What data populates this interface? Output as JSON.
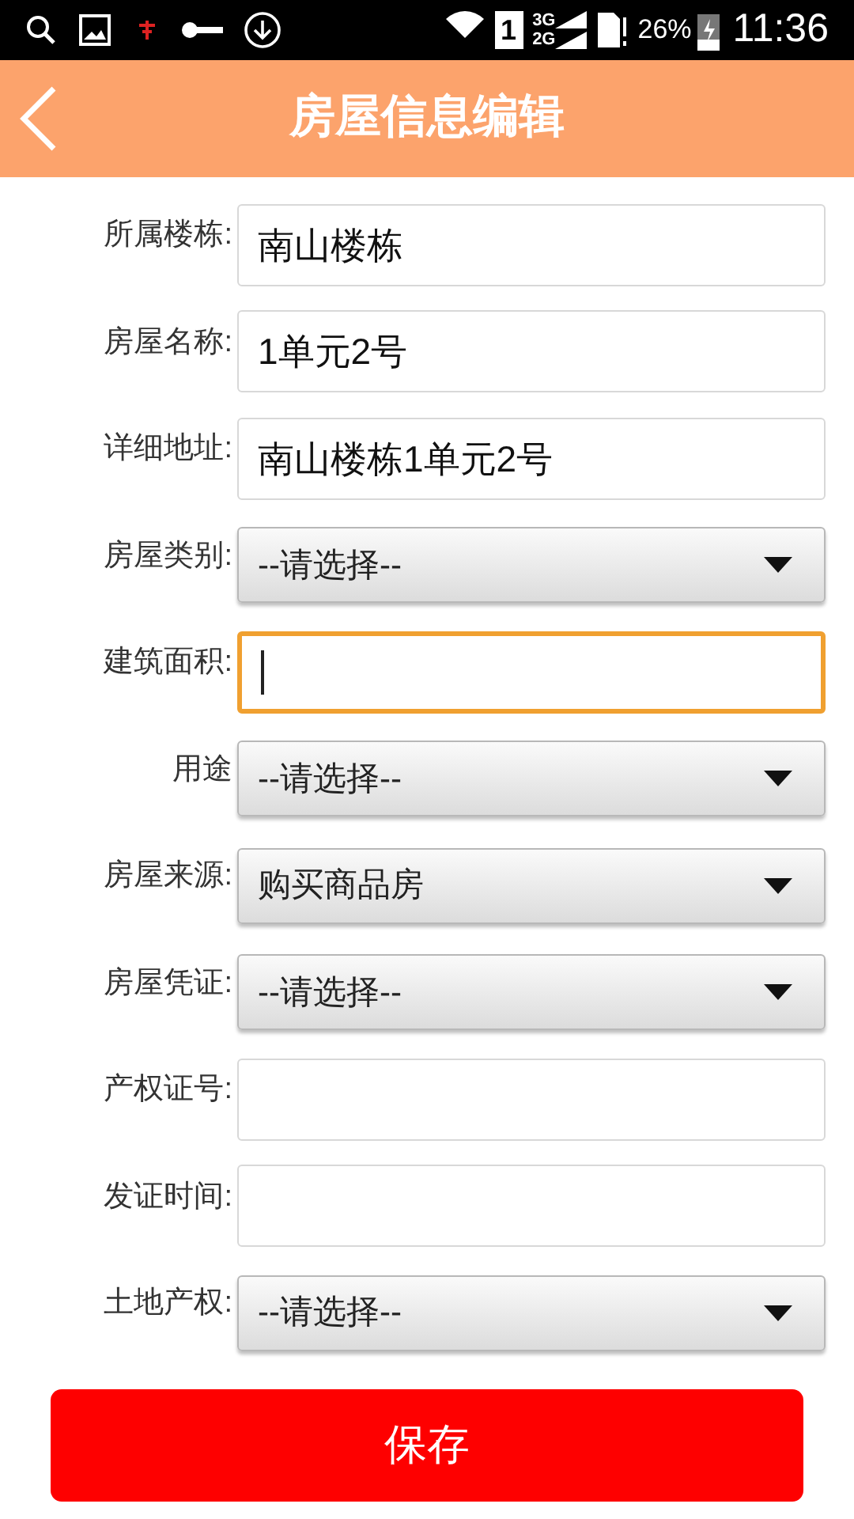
{
  "status_bar": {
    "sim": "1",
    "network_top": "3G",
    "network_bottom": "2G",
    "battery": "26%",
    "time": "11:36"
  },
  "header": {
    "title": "房屋信息编辑"
  },
  "fields": [
    {
      "kind": "text",
      "label": "所属楼栋:",
      "value": "南山楼栋",
      "focused": false
    },
    {
      "kind": "text",
      "label": "房屋名称:",
      "value": "1单元2号",
      "focused": false
    },
    {
      "kind": "text",
      "label": "详细地址:",
      "value": "南山楼栋1单元2号",
      "focused": false
    },
    {
      "kind": "select",
      "label": "房屋类别:",
      "value": "--请选择--"
    },
    {
      "kind": "text",
      "label": "建筑面积:",
      "focused": true
    },
    {
      "kind": "select",
      "label": "用途",
      "value": "--请选择--"
    },
    {
      "kind": "select",
      "label": "房屋来源:",
      "value": "购买商品房"
    },
    {
      "kind": "select",
      "label": "房屋凭证:",
      "value": "--请选择--"
    },
    {
      "kind": "text",
      "label": "产权证号:",
      "focused": false
    },
    {
      "kind": "text",
      "label": "发证时间:",
      "focused": false
    },
    {
      "kind": "select",
      "label": "土地产权:",
      "value": "--请选择--"
    }
  ],
  "save_button": "保存"
}
